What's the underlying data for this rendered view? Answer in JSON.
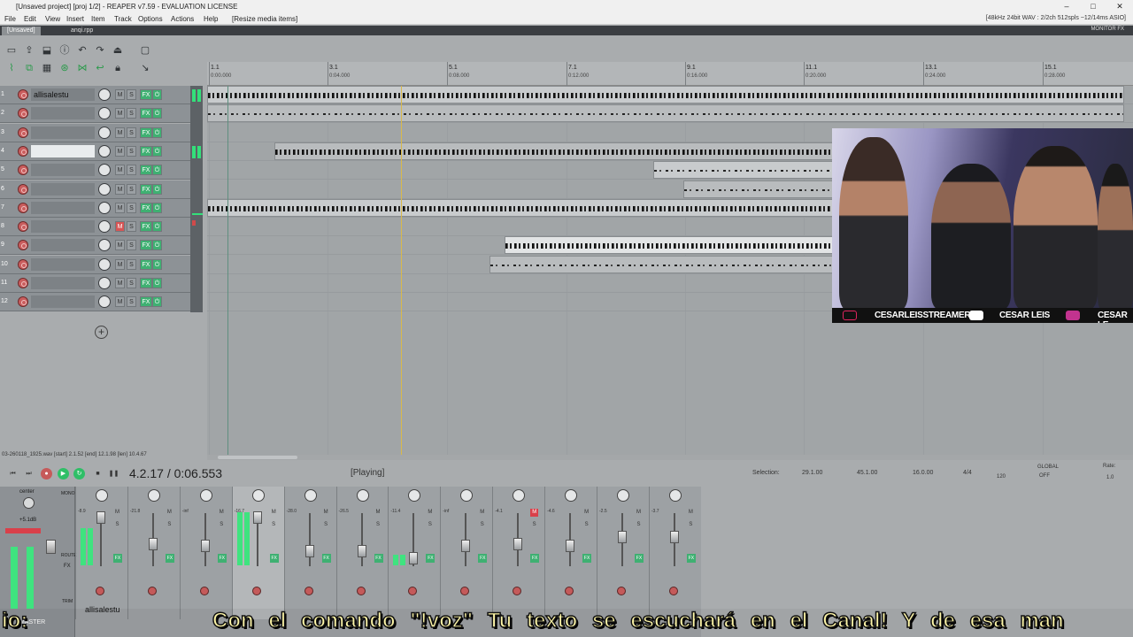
{
  "window": {
    "title": "[Unsaved project] [proj 1/2] - REAPER v7.59 - EVALUATION LICENSE",
    "controls": [
      "–",
      "□",
      "✕"
    ]
  },
  "menu": {
    "items": [
      "File",
      "Edit",
      "View",
      "Insert",
      "Item",
      "Track",
      "Options",
      "Actions",
      "Help",
      "[Resize media items]"
    ],
    "status_right": "[48kHz 24bit WAV : 2/2ch 512spls ~12/14ms ASIO]"
  },
  "tabs": {
    "items": [
      "[Unsaved]",
      "anqi.rpp"
    ],
    "monitor": "MONITOR FX"
  },
  "ruler": {
    "bars": [
      "1.1",
      "3.1",
      "5.1",
      "7.1",
      "9.1",
      "11.1",
      "13.1",
      "15.1"
    ],
    "times": [
      "0:00.000",
      "0:04.000",
      "0:08.000",
      "0:12.000",
      "0:16.000",
      "0:20.000",
      "0:24.000",
      "0:28.000"
    ]
  },
  "tracks": [
    {
      "num": "1",
      "name": "allisalestu"
    },
    {
      "num": "2",
      "name": ""
    },
    {
      "num": "3",
      "name": ""
    },
    {
      "num": "4",
      "name": ""
    },
    {
      "num": "5",
      "name": ""
    },
    {
      "num": "6",
      "name": ""
    },
    {
      "num": "7",
      "name": ""
    },
    {
      "num": "8",
      "name": ""
    },
    {
      "num": "9",
      "name": ""
    },
    {
      "num": "10",
      "name": ""
    },
    {
      "num": "11",
      "name": ""
    },
    {
      "num": "12",
      "name": ""
    }
  ],
  "track_buttons": {
    "m": "M",
    "s": "S",
    "fx": "FX",
    "io": "⏻"
  },
  "add_track": "+",
  "status_line": "03-260118_1925.wav [start] 2.1.52 [end] 12.1.98 [len] 10.4.67",
  "transport": {
    "position": "4.2.17 / 0:06.553",
    "state": "[Playing]",
    "selection_label": "Selection:",
    "sel_start": "29.1.00",
    "sel_end": "45.1.00",
    "sel_len": "16.0.00",
    "time_sig": "4/4",
    "bpm": "120",
    "global": "GLOBAL",
    "global_state": "OFF",
    "rate_label": "Rate:",
    "rate": "1.0"
  },
  "master": {
    "label": "center",
    "peak": "+5.1dB",
    "mono": "MONO",
    "route": "ROUTE",
    "fx": "FX",
    "trim": "TRIM",
    "name": "MASTER"
  },
  "mixer": {
    "strip_db": [
      "-8.9",
      "-21.8",
      "-inf",
      "-16.7",
      "-28.0",
      "-26.5",
      "-11.4",
      "-inf",
      "-4.1",
      "-4.6",
      "-2.5",
      "-3.7"
    ],
    "first_strip_name": "allisalestu",
    "labels": {
      "m": "M",
      "s": "S",
      "fx": "FX"
    }
  },
  "webcam": {
    "tiktok": "CESARLEISSTREAMER",
    "youtube": "CESAR LEIS",
    "instagram": "CESAR LE"
  },
  "subtitle": {
    "left": "io:",
    "main": "Con el comando \"!voz\" Tu texto se escuchará en el Canal! Y de esa man"
  },
  "colors": {
    "accent_green": "#3fb072",
    "rec_red": "#c95d5d",
    "play_cursor": "#d9b94a"
  }
}
